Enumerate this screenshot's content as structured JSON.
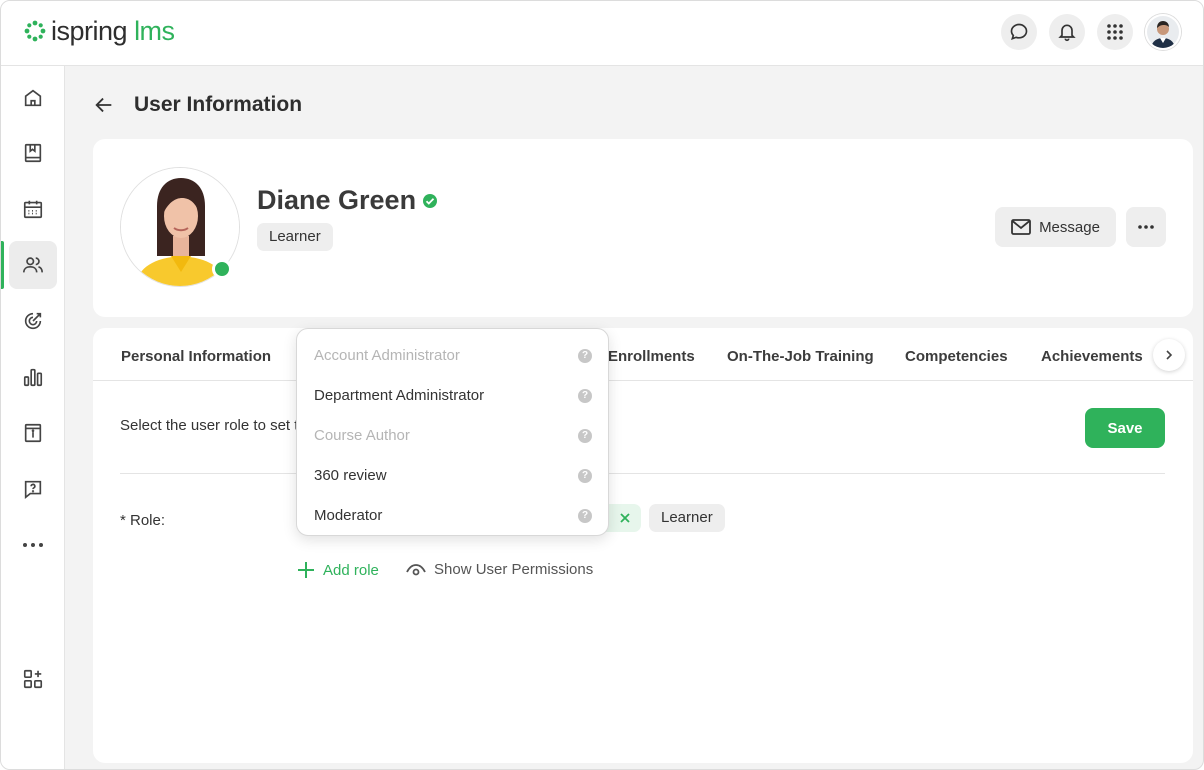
{
  "app": {
    "logo_text_main": "ispring",
    "logo_text_accent": "lms",
    "accent_color": "#2fb25b"
  },
  "topbar": {
    "icons": [
      "chat-icon",
      "bell-icon",
      "apps-grid-icon"
    ]
  },
  "sidebar": {
    "items": [
      {
        "icon": "home-icon",
        "active": false
      },
      {
        "icon": "book-icon",
        "active": false
      },
      {
        "icon": "calendar-icon",
        "active": false
      },
      {
        "icon": "users-icon",
        "active": true
      },
      {
        "icon": "target-icon",
        "active": false
      },
      {
        "icon": "bar-chart-icon",
        "active": false
      },
      {
        "icon": "info-box-icon",
        "active": false
      },
      {
        "icon": "question-chat-icon",
        "active": false
      },
      {
        "icon": "more-dots-icon",
        "active": false
      },
      {
        "icon": "add-widget-icon",
        "active": false
      }
    ]
  },
  "page": {
    "title": "User Information"
  },
  "profile": {
    "name": "Diane Green",
    "role_badge": "Learner",
    "message_label": "Message",
    "online": true
  },
  "tabs": [
    {
      "label": "Personal Information"
    },
    {
      "label": "Enrollments"
    },
    {
      "label": "On-The-Job Training"
    },
    {
      "label": "Competencies"
    },
    {
      "label": "Achievements"
    }
  ],
  "roles_panel": {
    "hint": "Select the user role to set t",
    "save_label": "Save",
    "role_label": "* Role:",
    "assigned_role": "Learner",
    "add_role_label": "Add role",
    "show_permissions_label": "Show User Permissions"
  },
  "role_dropdown": {
    "options": [
      {
        "label": "Account Administrator",
        "disabled": true
      },
      {
        "label": "Department Administrator",
        "disabled": false
      },
      {
        "label": "Course Author",
        "disabled": true
      },
      {
        "label": "360 review",
        "disabled": false
      },
      {
        "label": "Moderator",
        "disabled": false
      }
    ]
  }
}
